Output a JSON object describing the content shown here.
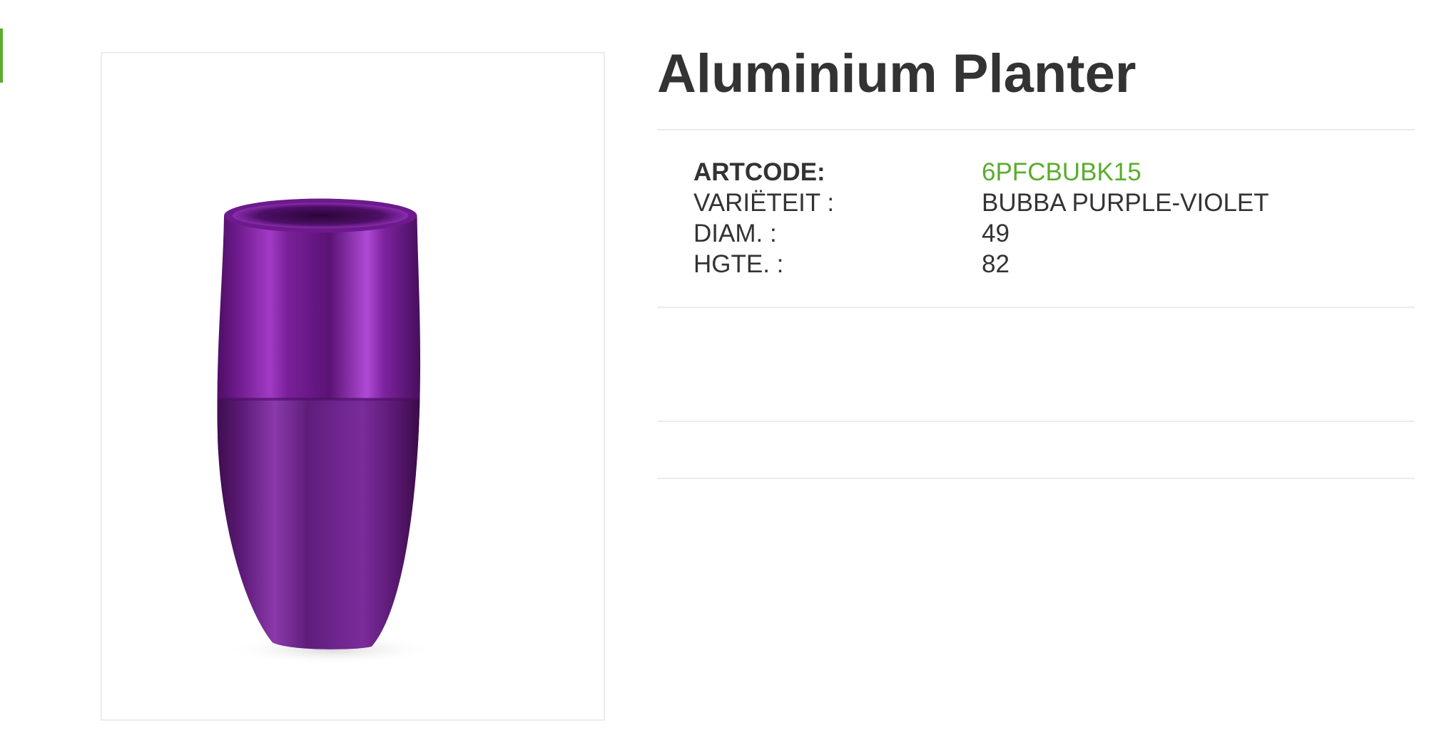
{
  "product": {
    "title": "Aluminium Planter",
    "image_alt": "Purple-violet aluminium planter",
    "specs": [
      {
        "label": "ARTCODE:",
        "value": "6PFCBUBK15"
      },
      {
        "label": "VARIËTEIT :",
        "value": "BUBBA PURPLE-VIOLET"
      },
      {
        "label": "DIAM. :",
        "value": "49"
      },
      {
        "label": "HGTE. :",
        "value": "82"
      }
    ]
  },
  "colors": {
    "accent": "#5aac2e",
    "text": "#333333",
    "divider": "#ececec",
    "planter_top": "#7a1f9a",
    "planter_bottom": "#5e1d78"
  }
}
